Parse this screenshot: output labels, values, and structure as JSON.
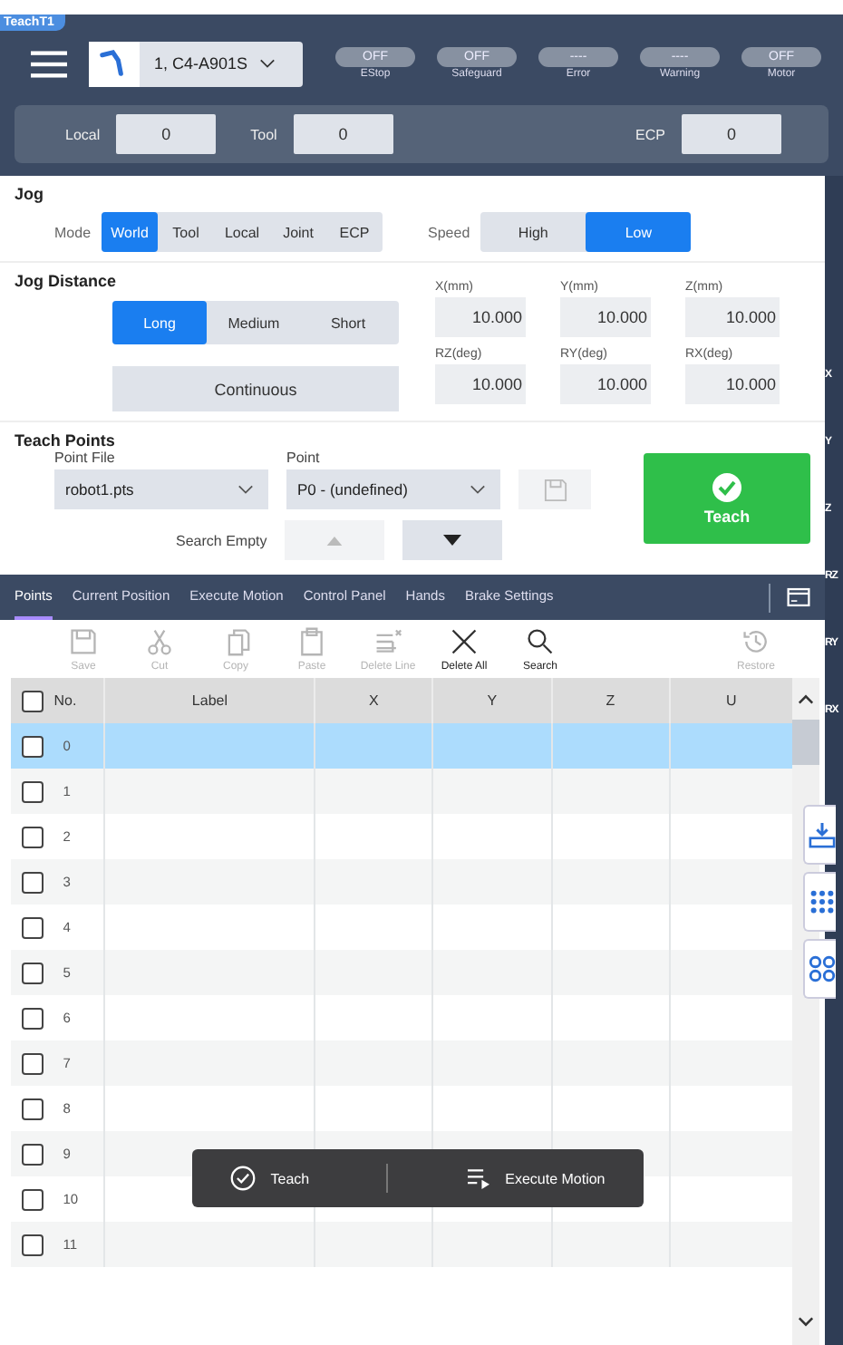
{
  "header": {
    "tab_label": "TeachT1",
    "robot": "1, C4-A901S",
    "statuses": [
      {
        "value": "OFF",
        "label": "EStop"
      },
      {
        "value": "OFF",
        "label": "Safeguard"
      },
      {
        "value": "----",
        "label": "Error"
      },
      {
        "value": "----",
        "label": "Warning"
      },
      {
        "value": "OFF",
        "label": "Motor"
      }
    ],
    "frames": [
      {
        "label": "Local",
        "value": "0"
      },
      {
        "label": "Tool",
        "value": "0"
      },
      {
        "label": "ECP",
        "value": "0"
      }
    ]
  },
  "jog": {
    "title": "Jog",
    "mode_label": "Mode",
    "modes": [
      {
        "label": "World",
        "selected": true
      },
      {
        "label": "Tool",
        "selected": false
      },
      {
        "label": "Local",
        "selected": false
      },
      {
        "label": "Joint",
        "selected": false
      },
      {
        "label": "ECP",
        "selected": false
      }
    ],
    "speed_label": "Speed",
    "speeds": [
      {
        "label": "High",
        "selected": false
      },
      {
        "label": "Low",
        "selected": true
      }
    ]
  },
  "jog_distance": {
    "title": "Jog Distance",
    "distances": [
      {
        "label": "Long",
        "selected": true
      },
      {
        "label": "Medium",
        "selected": false
      },
      {
        "label": "Short",
        "selected": false
      }
    ],
    "continuous": "Continuous",
    "values": [
      {
        "label": "X(mm)",
        "value": "10.000"
      },
      {
        "label": "Y(mm)",
        "value": "10.000"
      },
      {
        "label": "Z(mm)",
        "value": "10.000"
      },
      {
        "label": "RZ(deg)",
        "value": "10.000"
      },
      {
        "label": "RY(deg)",
        "value": "10.000"
      },
      {
        "label": "RX(deg)",
        "value": "10.000"
      }
    ]
  },
  "teach_points": {
    "title": "Teach Points",
    "point_file_label": "Point File",
    "point_file": "robot1.pts",
    "point_label": "Point",
    "point": "P0 - (undefined)",
    "search_empty": "Search Empty",
    "teach": "Teach"
  },
  "tabs": [
    {
      "label": "Points",
      "selected": true
    },
    {
      "label": "Current Position",
      "selected": false
    },
    {
      "label": "Execute Motion",
      "selected": false
    },
    {
      "label": "Control Panel",
      "selected": false
    },
    {
      "label": "Hands",
      "selected": false
    },
    {
      "label": "Brake Settings",
      "selected": false
    }
  ],
  "toolbar": [
    {
      "kind": "save",
      "label": "Save",
      "disabled": true
    },
    {
      "kind": "cut",
      "label": "Cut",
      "disabled": true
    },
    {
      "kind": "copy",
      "label": "Copy",
      "disabled": true
    },
    {
      "kind": "paste",
      "label": "Paste",
      "disabled": true
    },
    {
      "kind": "deleteline",
      "label": "Delete Line",
      "disabled": true
    },
    {
      "kind": "deleteall",
      "label": "Delete All",
      "disabled": false
    },
    {
      "kind": "search",
      "label": "Search",
      "disabled": false
    },
    {
      "kind": "restore",
      "label": "Restore",
      "disabled": true
    }
  ],
  "table": {
    "select_all_checked": false,
    "columns": [
      "No.",
      "Label",
      "X",
      "Y",
      "Z",
      "U"
    ],
    "rows": [
      {
        "no": "0",
        "selected": true,
        "checked": false
      },
      {
        "no": "1",
        "selected": false,
        "checked": false
      },
      {
        "no": "2",
        "selected": false,
        "checked": false
      },
      {
        "no": "3",
        "selected": false,
        "checked": false
      },
      {
        "no": "4",
        "selected": false,
        "checked": false
      },
      {
        "no": "5",
        "selected": false,
        "checked": false
      },
      {
        "no": "6",
        "selected": false,
        "checked": false
      },
      {
        "no": "7",
        "selected": false,
        "checked": false
      },
      {
        "no": "8",
        "selected": false,
        "checked": false
      },
      {
        "no": "9",
        "selected": false,
        "checked": false
      },
      {
        "no": "10",
        "selected": false,
        "checked": false
      },
      {
        "no": "11",
        "selected": false,
        "checked": false
      }
    ]
  },
  "action_bar": [
    {
      "kind": "teach",
      "label": "Teach"
    },
    {
      "kind": "execute",
      "label": "Execute Motion"
    }
  ],
  "side_strip": [
    "X",
    "Y",
    "Z",
    "RZ",
    "RY",
    "RX"
  ]
}
